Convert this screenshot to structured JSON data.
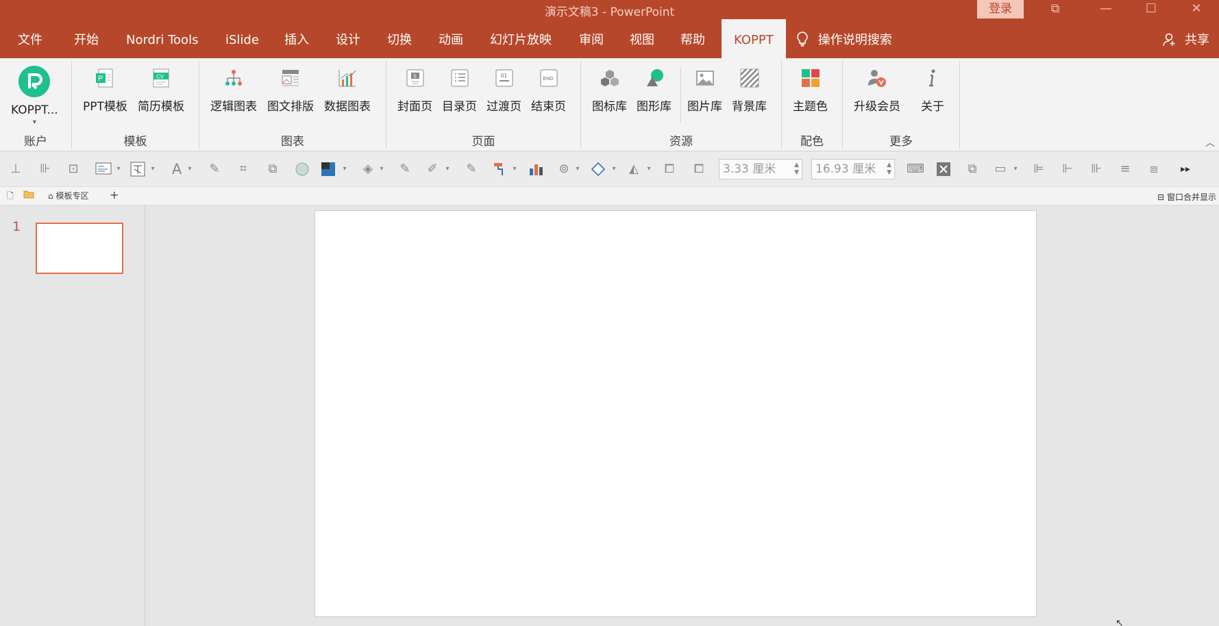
{
  "window": {
    "title": "演示文稿3  -  PowerPoint",
    "login_label": "登录",
    "controls": [
      "⧉",
      "—",
      "☐",
      "✕"
    ]
  },
  "tabs": [
    "文件",
    "开始",
    "Nordri Tools",
    "iSlide",
    "插入",
    "设计",
    "切换",
    "动画",
    "幻灯片放映",
    "审阅",
    "视图",
    "帮助",
    "KOPPT"
  ],
  "active_tab": "KOPPT",
  "search_label": "操作说明搜索",
  "share_label": "共享",
  "ribbon": {
    "groups": [
      {
        "label": "账户",
        "buttons": [
          "KOPPT..."
        ]
      },
      {
        "label": "模板",
        "buttons": [
          "PPT模板",
          "简历模板"
        ]
      },
      {
        "label": "图表",
        "buttons": [
          "逻辑图表",
          "图文排版",
          "数据图表"
        ]
      },
      {
        "label": "页面",
        "buttons": [
          "封面页",
          "目录页",
          "过渡页",
          "结束页"
        ]
      },
      {
        "label": "资源",
        "buttons": [
          "图标库",
          "图形库",
          "图片库",
          "背景库"
        ]
      },
      {
        "label": "配色",
        "buttons": [
          "主题色"
        ]
      },
      {
        "label": "更多",
        "buttons": [
          "升级会员",
          "关于"
        ]
      }
    ],
    "icon_labels": {
      "cv": "CV",
      "p": "P",
      "s": "S",
      "end": "END",
      "o1": "01"
    }
  },
  "toolstrip": {
    "width_value": "3.33 厘米",
    "height_value": "16.93 厘米"
  },
  "doctabs": {
    "template_zone": "模板专区",
    "add_label": "+",
    "merge_label": "窗口合并显示"
  },
  "slides": {
    "current_number": "1"
  },
  "colors": {
    "accent": "#b7472a",
    "ribbon_bg": "#f3f3f3",
    "workspace_bg": "#e6e6e6",
    "thumb_border": "#e0704d",
    "brand_teal": "#1fbf8f"
  }
}
